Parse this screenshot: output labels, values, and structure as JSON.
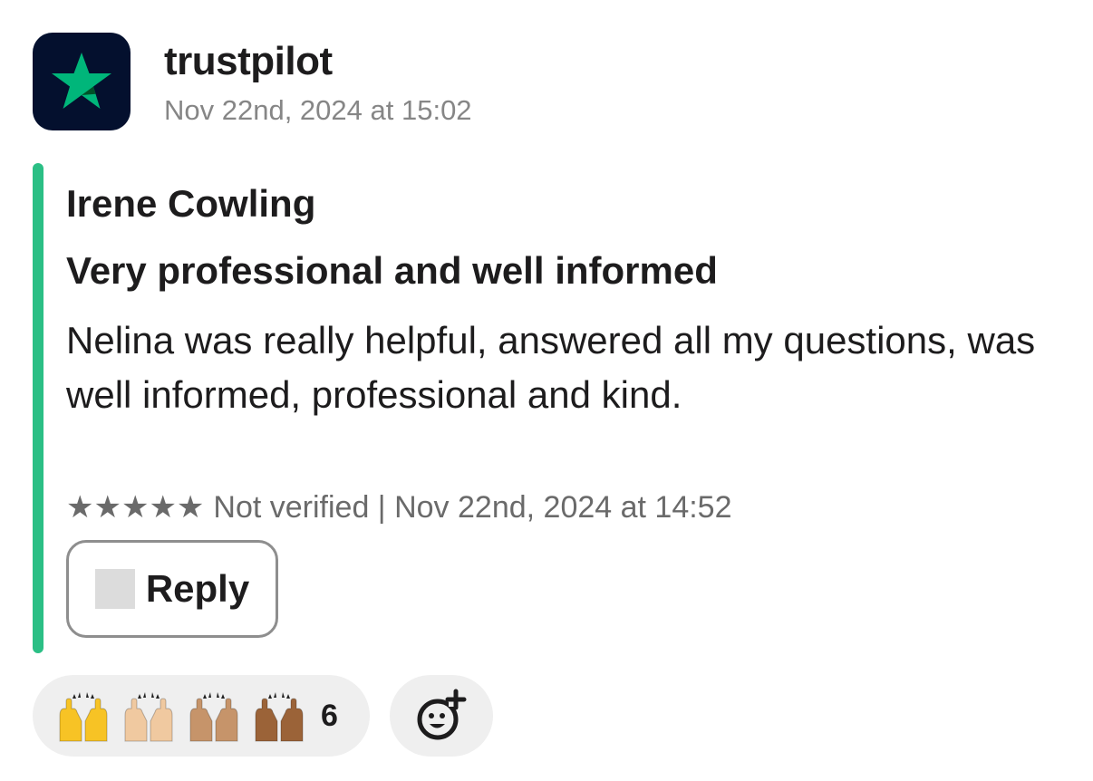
{
  "message": {
    "sender": "trustpilot",
    "timestamp": "Nov 22nd, 2024 at 15:02",
    "avatar_icon": "trustpilot-star-logo",
    "avatar_bg": "#04102e",
    "avatar_star_color": "#00b67a"
  },
  "attachment": {
    "accent_color": "#2bbf85",
    "reviewer_name": "Irene Cowling",
    "review_title": "Very professional and well informed",
    "review_text": "Nelina was really helpful, answered all my questions, was well informed, professional and kind.",
    "rating_stars": 5,
    "star_glyph": "★★★★★",
    "verification_and_date": "Not verified | Nov 22nd, 2024 at 14:52",
    "reply_button_label": "Reply",
    "reply_icon": "missing-image-placeholder"
  },
  "reactions": {
    "emoji_name": "raised-hands",
    "skin_tones": [
      "#f7c325",
      "#f0c9a0",
      "#c6946a",
      "#9b6338"
    ],
    "count": "6",
    "add_reaction_icon": "add-reaction-smiley-icon"
  }
}
